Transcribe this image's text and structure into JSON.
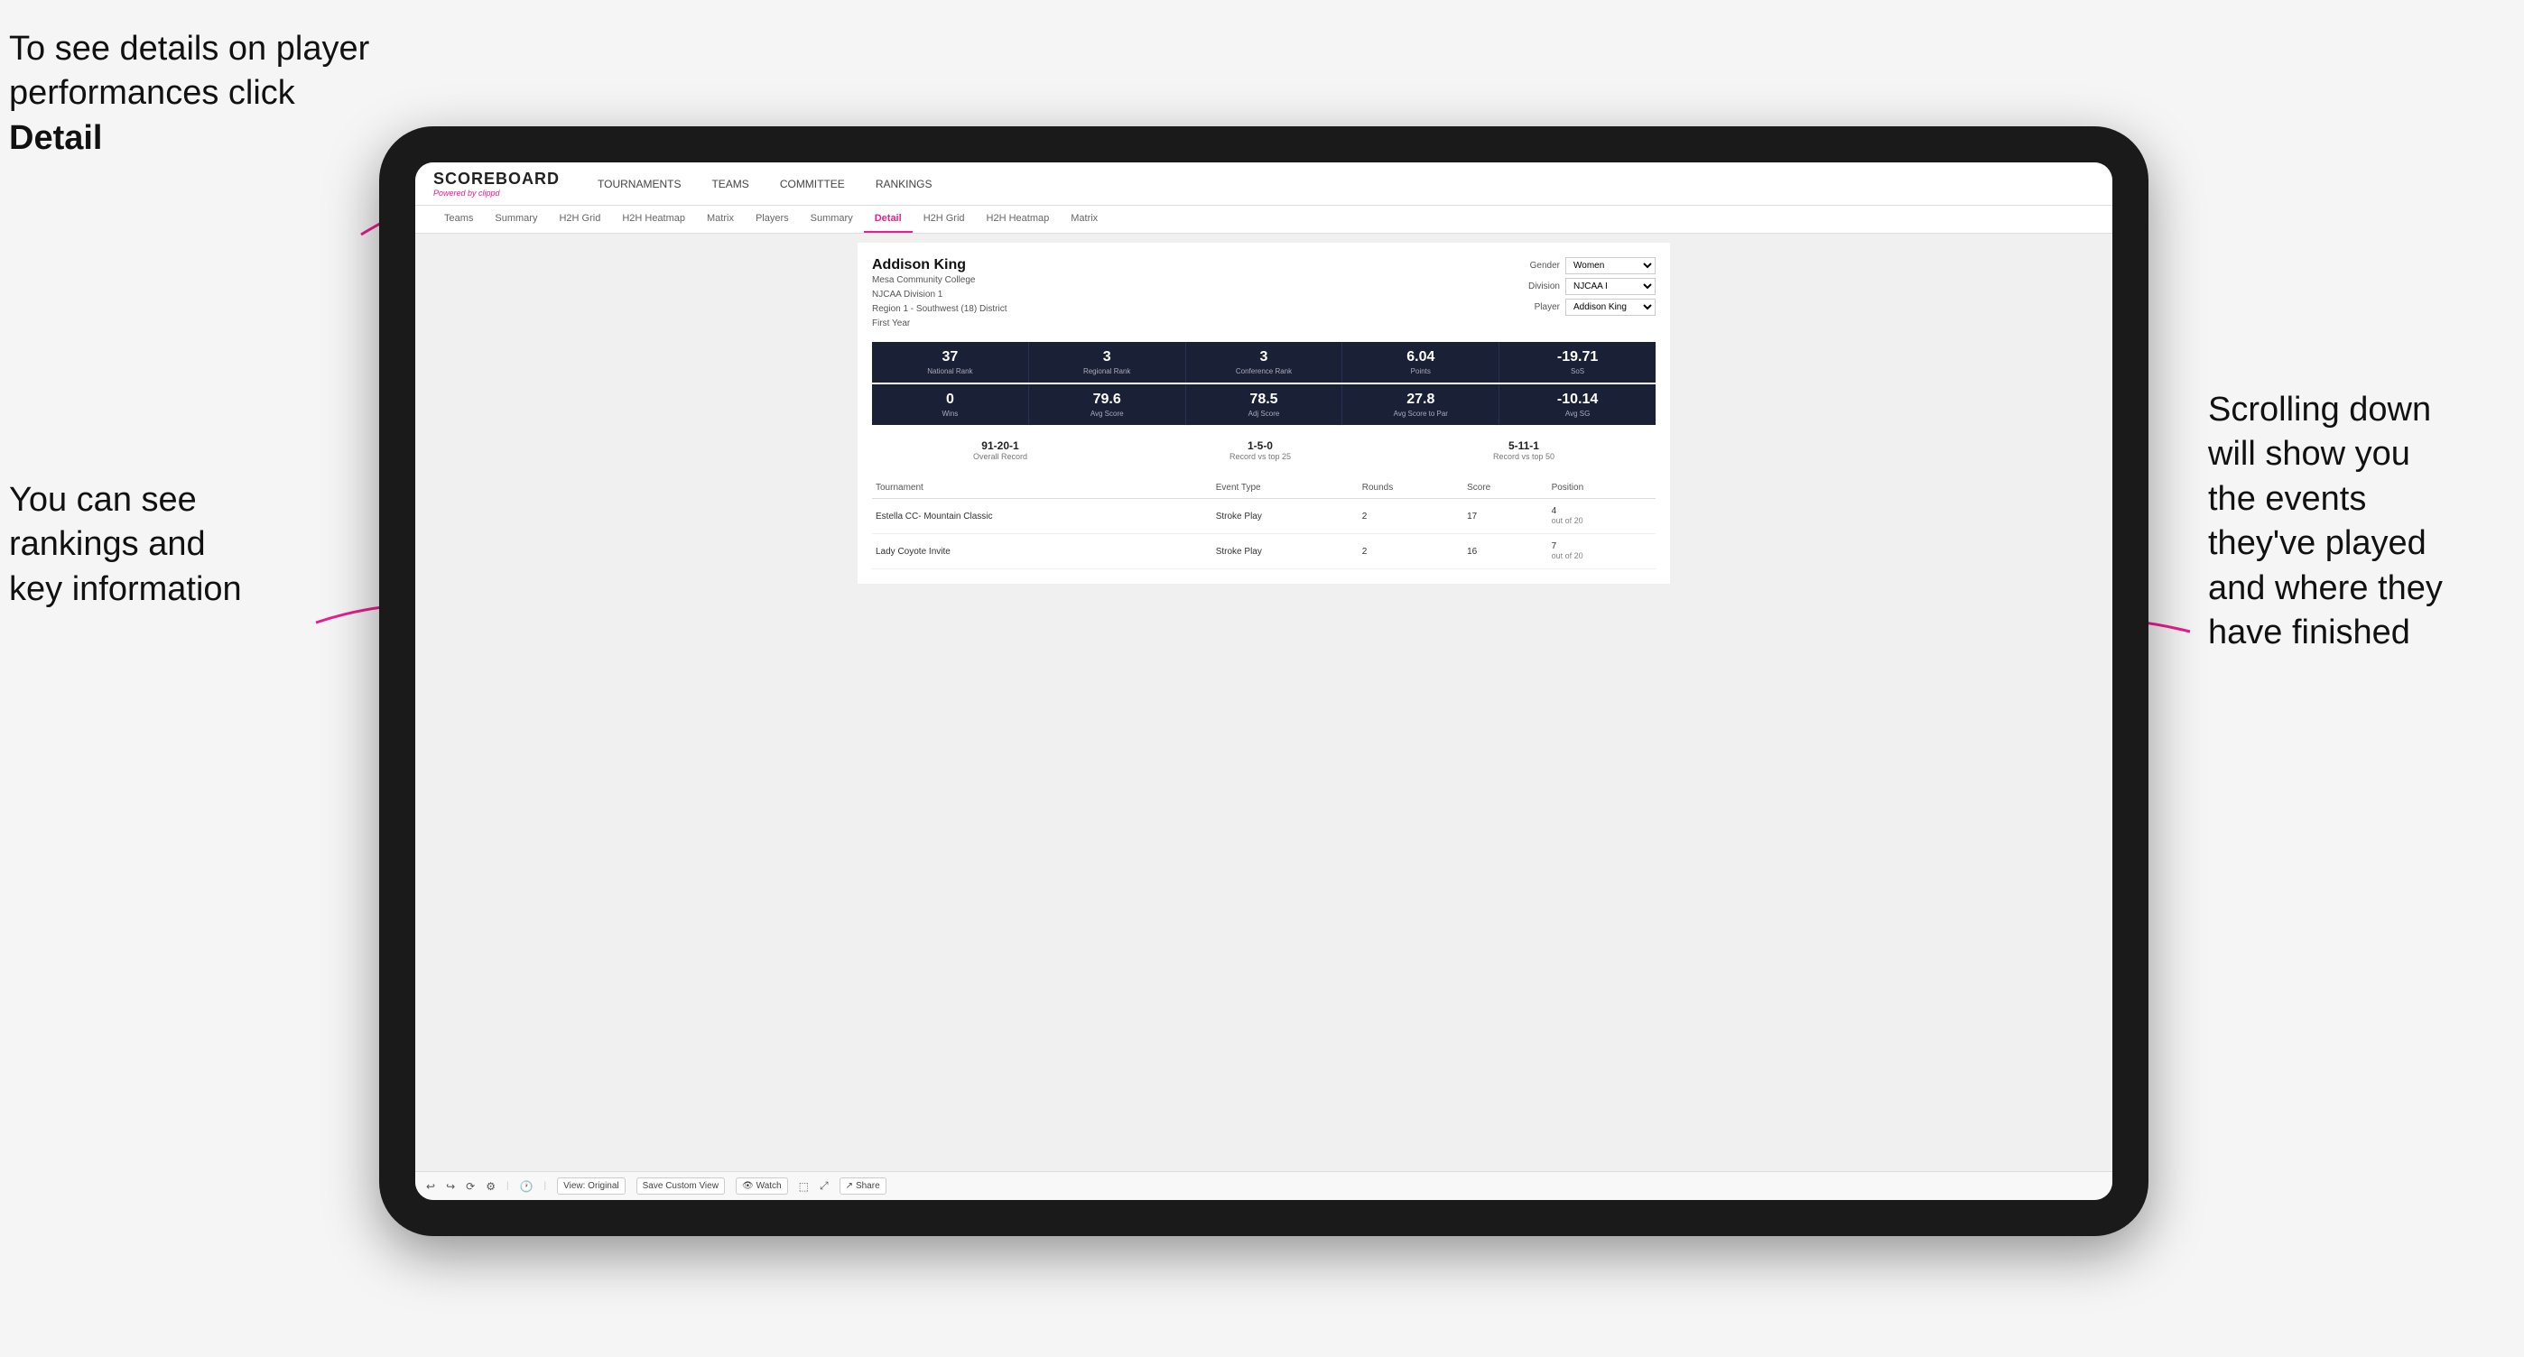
{
  "annotations": {
    "top_left": "To see details on player performances click ",
    "top_left_bold": "Detail",
    "bottom_left_line1": "You can see",
    "bottom_left_line2": "rankings and",
    "bottom_left_line3": "key information",
    "right_line1": "Scrolling down",
    "right_line2": "will show you",
    "right_line3": "the events",
    "right_line4": "they've played",
    "right_line5": "and where they",
    "right_line6": "have finished"
  },
  "navbar": {
    "logo": "SCOREBOARD",
    "powered_by": "Powered by",
    "brand": "clippd",
    "nav_items": [
      "TOURNAMENTS",
      "TEAMS",
      "COMMITTEE",
      "RANKINGS"
    ]
  },
  "sub_tabs": [
    {
      "label": "Teams",
      "active": false
    },
    {
      "label": "Summary",
      "active": false
    },
    {
      "label": "H2H Grid",
      "active": false
    },
    {
      "label": "H2H Heatmap",
      "active": false
    },
    {
      "label": "Matrix",
      "active": false
    },
    {
      "label": "Players",
      "active": false
    },
    {
      "label": "Summary",
      "active": false
    },
    {
      "label": "Detail",
      "active": true
    },
    {
      "label": "H2H Grid",
      "active": false
    },
    {
      "label": "H2H Heatmap",
      "active": false
    },
    {
      "label": "Matrix",
      "active": false
    }
  ],
  "player": {
    "name": "Addison King",
    "school": "Mesa Community College",
    "division": "NJCAA Division 1",
    "region": "Region 1 - Southwest (18) District",
    "year": "First Year"
  },
  "filters": {
    "gender_label": "Gender",
    "gender_value": "Women",
    "division_label": "Division",
    "division_value": "NJCAA I",
    "player_label": "Player",
    "player_value": "Addison King"
  },
  "stats_row1": [
    {
      "value": "37",
      "label": "National Rank"
    },
    {
      "value": "3",
      "label": "Regional Rank"
    },
    {
      "value": "3",
      "label": "Conference Rank"
    },
    {
      "value": "6.04",
      "label": "Points"
    },
    {
      "value": "-19.71",
      "label": "SoS"
    }
  ],
  "stats_row2": [
    {
      "value": "0",
      "label": "Wins"
    },
    {
      "value": "79.6",
      "label": "Avg Score"
    },
    {
      "value": "78.5",
      "label": "Adj Score"
    },
    {
      "value": "27.8",
      "label": "Avg Score to Par"
    },
    {
      "value": "-10.14",
      "label": "Avg SG"
    }
  ],
  "records": [
    {
      "value": "91-20-1",
      "label": "Overall Record"
    },
    {
      "value": "1-5-0",
      "label": "Record vs top 25"
    },
    {
      "value": "5-11-1",
      "label": "Record vs top 50"
    }
  ],
  "table": {
    "headers": [
      "Tournament",
      "Event Type",
      "Rounds",
      "Score",
      "Position"
    ],
    "rows": [
      {
        "tournament": "Estella CC- Mountain Classic",
        "event_type": "Stroke Play",
        "rounds": "2",
        "score": "17",
        "position": "4",
        "position_detail": "out of 20"
      },
      {
        "tournament": "Lady Coyote Invite",
        "event_type": "Stroke Play",
        "rounds": "2",
        "score": "16",
        "position": "7",
        "position_detail": "out of 20"
      }
    ]
  },
  "toolbar": {
    "undo": "↩",
    "redo": "↪",
    "view_original": "View: Original",
    "save_custom": "Save Custom View",
    "watch": "Watch",
    "share": "Share"
  }
}
